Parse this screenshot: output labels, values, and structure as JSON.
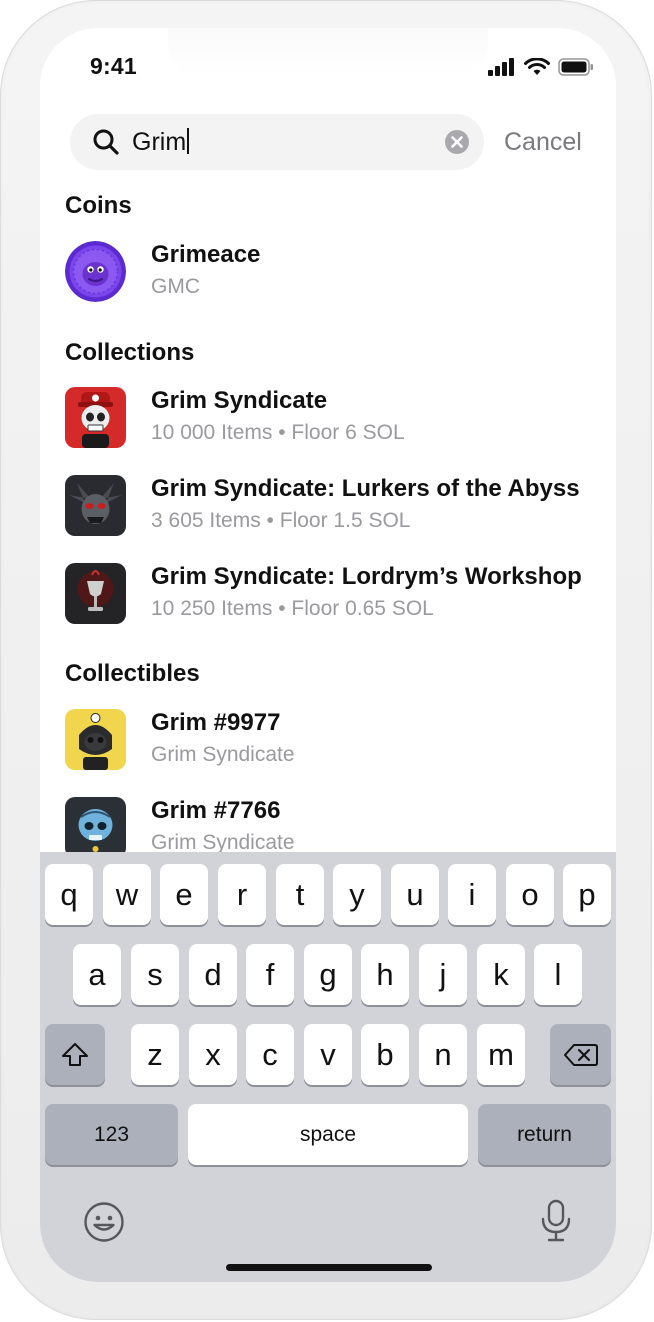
{
  "status": {
    "time": "9:41"
  },
  "search": {
    "query": "Grim",
    "cancel_label": "Cancel"
  },
  "sections": {
    "coins": {
      "title": "Coins",
      "items": [
        {
          "title": "Grimeace",
          "subtitle": "GMC"
        }
      ]
    },
    "collections": {
      "title": "Collections",
      "items": [
        {
          "title": "Grim Syndicate",
          "subtitle": "10 000 Items • Floor 6 SOL"
        },
        {
          "title": "Grim Syndicate: Lurkers of the Abyss",
          "subtitle": "3 605 Items • Floor 1.5 SOL"
        },
        {
          "title": "Grim Syndicate: Lordrym’s Workshop",
          "subtitle": "10 250 Items • Floor 0.65 SOL"
        }
      ]
    },
    "collectibles": {
      "title": "Collectibles",
      "items": [
        {
          "title": "Grim #9977",
          "subtitle": "Grim Syndicate"
        },
        {
          "title": "Grim #7766",
          "subtitle": "Grim Syndicate"
        }
      ]
    }
  },
  "keyboard": {
    "row1": [
      "q",
      "w",
      "e",
      "r",
      "t",
      "y",
      "u",
      "i",
      "o",
      "p"
    ],
    "row2": [
      "a",
      "s",
      "d",
      "f",
      "g",
      "h",
      "j",
      "k",
      "l"
    ],
    "row3": [
      "z",
      "x",
      "c",
      "v",
      "b",
      "n",
      "m"
    ],
    "numbers_label": "123",
    "space_label": "space",
    "return_label": "return"
  },
  "icons": {
    "search": "search-icon",
    "clear": "clear-icon",
    "shift": "shift-icon",
    "delete": "delete-icon",
    "emoji": "emoji-icon",
    "mic": "microphone-icon",
    "signal": "signal-icon",
    "wifi": "wifi-icon",
    "battery": "battery-icon"
  },
  "colors": {
    "keyboard_bg": "#d1d3d9",
    "key_light": "#ffffff",
    "key_dark": "#abb0ba",
    "secondary_text": "#9a9a9e",
    "search_bg": "#f3f3f4"
  }
}
